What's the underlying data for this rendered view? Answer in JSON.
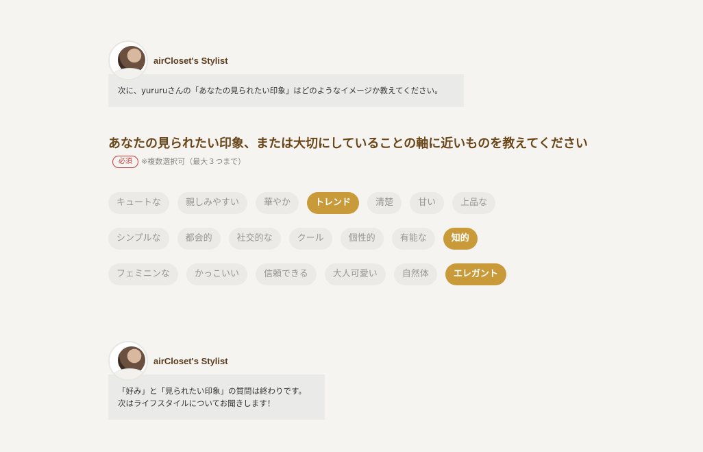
{
  "stylist_1": {
    "name": "airCloset's Stylist",
    "message": "次に、yururuさんの「あなたの見られたい印象」はどのようなイメージか教えてください。"
  },
  "question": {
    "title": "あなたの見られたい印象、または大切にしていることの軸に近いものを教えてください",
    "required_label": "必須",
    "note": "※複数選択可（最大３つまで）"
  },
  "options": {
    "row1": [
      {
        "label": "キュートな",
        "selected": false
      },
      {
        "label": "親しみやすい",
        "selected": false
      },
      {
        "label": "華やか",
        "selected": false
      },
      {
        "label": "トレンド",
        "selected": true
      },
      {
        "label": "清楚",
        "selected": false
      },
      {
        "label": "甘い",
        "selected": false
      },
      {
        "label": "上品な",
        "selected": false
      }
    ],
    "row2": [
      {
        "label": "シンプルな",
        "selected": false
      },
      {
        "label": "都会的",
        "selected": false
      },
      {
        "label": "社交的な",
        "selected": false
      },
      {
        "label": "クール",
        "selected": false
      },
      {
        "label": "個性的",
        "selected": false
      },
      {
        "label": "有能な",
        "selected": false
      },
      {
        "label": "知的",
        "selected": true
      }
    ],
    "row3": [
      {
        "label": "フェミニンな",
        "selected": false
      },
      {
        "label": "かっこいい",
        "selected": false
      },
      {
        "label": "信頼できる",
        "selected": false
      },
      {
        "label": "大人可愛い",
        "selected": false
      },
      {
        "label": "自然体",
        "selected": false
      },
      {
        "label": "エレガント",
        "selected": true
      }
    ]
  },
  "stylist_2": {
    "name": "airCloset's Stylist",
    "message_line1": "「好み」と「見られたい印象」の質問は終わりです。",
    "message_line2": "次はライフスタイルについてお聞きします！"
  },
  "colors": {
    "background": "#f5f4f1",
    "accent": "#c99a3a",
    "title": "#6a4517",
    "required": "#c5373a"
  }
}
